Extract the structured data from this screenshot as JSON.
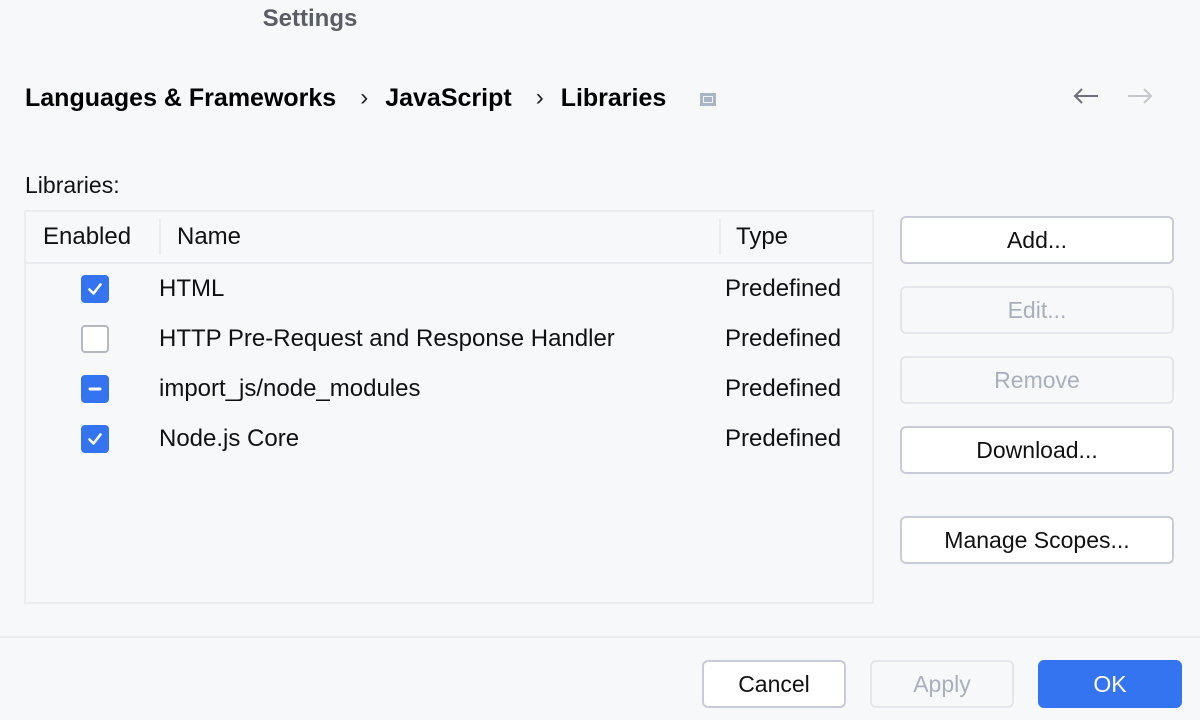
{
  "window": {
    "title": "Settings"
  },
  "breadcrumb": {
    "items": [
      "Languages & Frameworks",
      "JavaScript",
      "Libraries"
    ],
    "separator": "›",
    "pin_icon": "window-pin-icon"
  },
  "nav": {
    "back_icon": "arrow-left-icon",
    "forward_icon": "arrow-right-icon",
    "back_enabled": true,
    "forward_enabled": false
  },
  "libraries": {
    "label": "Libraries:",
    "columns": [
      "Enabled",
      "Name",
      "Type"
    ],
    "rows": [
      {
        "enabled": "checked",
        "name": "HTML",
        "type": "Predefined"
      },
      {
        "enabled": "unchecked",
        "name": "HTTP Pre-Request and Response Handler",
        "type": "Predefined"
      },
      {
        "enabled": "partial",
        "name": "import_js/node_modules",
        "type": "Predefined"
      },
      {
        "enabled": "checked",
        "name": "Node.js Core",
        "type": "Predefined"
      }
    ]
  },
  "side_buttons": {
    "add": {
      "label": "Add...",
      "enabled": true
    },
    "edit": {
      "label": "Edit...",
      "enabled": false
    },
    "remove": {
      "label": "Remove",
      "enabled": false
    },
    "download": {
      "label": "Download...",
      "enabled": true
    },
    "manage_scopes": {
      "label": "Manage Scopes...",
      "enabled": true
    }
  },
  "footer": {
    "cancel": {
      "label": "Cancel",
      "enabled": true
    },
    "apply": {
      "label": "Apply",
      "enabled": false
    },
    "ok": {
      "label": "OK",
      "enabled": true
    }
  },
  "colors": {
    "accent": "#3574f0",
    "background": "#f7f8fa",
    "border": "#ebecf0",
    "disabled_text": "#a9afbc"
  }
}
